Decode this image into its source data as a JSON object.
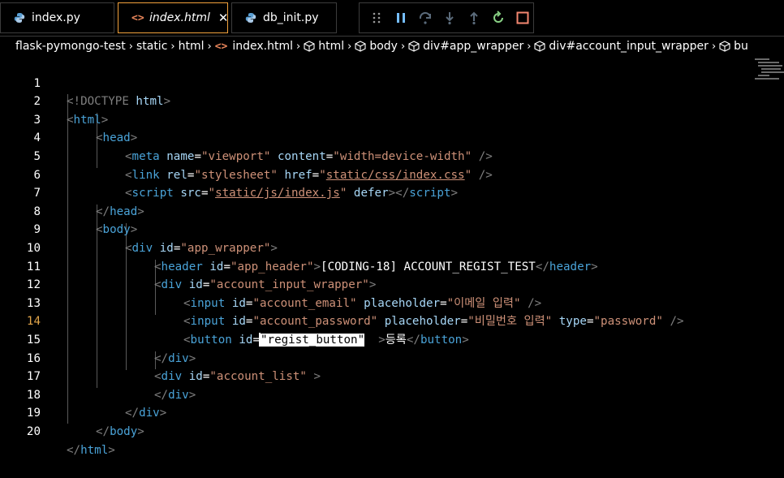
{
  "tabs": [
    {
      "label": "index.py",
      "icon": "python-icon",
      "active": false
    },
    {
      "label": "index.html",
      "icon": "html-icon",
      "active": true,
      "close": "✕"
    },
    {
      "label": "db_init.py",
      "icon": "python-icon",
      "active": false
    }
  ],
  "html_glyph": "<>",
  "debug_toolbar": [
    "drag-handle-icon",
    "pause-icon",
    "step-over-icon",
    "step-into-icon",
    "step-out-icon",
    "restart-icon",
    "stop-icon"
  ],
  "breadcrumb": {
    "segments": [
      "flask-pymongo-test",
      "static",
      "html",
      "index.html",
      "html",
      "body",
      "div#app_wrapper",
      "div#account_input_wrapper",
      "bu"
    ]
  },
  "editor": {
    "current_line": 14,
    "lines": [
      {
        "n": "1"
      },
      {
        "n": "2"
      },
      {
        "n": "3"
      },
      {
        "n": "4"
      },
      {
        "n": "5"
      },
      {
        "n": "6"
      },
      {
        "n": "7"
      },
      {
        "n": "8"
      },
      {
        "n": "9"
      },
      {
        "n": "10"
      },
      {
        "n": "11"
      },
      {
        "n": "12"
      },
      {
        "n": "13"
      },
      {
        "n": "14"
      },
      {
        "n": "15"
      },
      {
        "n": "16"
      },
      {
        "n": "17"
      },
      {
        "n": "18"
      },
      {
        "n": "19"
      },
      {
        "n": "20"
      }
    ],
    "code": {
      "doctype": "<!DOCTYPE",
      "html_kw": "html",
      "gt": ">",
      "lt": "<",
      "lt_slash": "</",
      "html": "html",
      "head": "head",
      "body": "body",
      "meta": "meta",
      "link": "link",
      "script": "script",
      "div": "div",
      "header": "header",
      "input": "input",
      "button": "button",
      "a_name": "name",
      "a_content": "content",
      "a_rel": "rel",
      "a_href": "href",
      "a_src": "src",
      "a_defer": "defer",
      "a_id": "id",
      "a_placeholder": "placeholder",
      "a_type": "type",
      "eq": "=",
      "v_viewport": "\"viewport\"",
      "v_width": "\"width=device-width\"",
      "v_stylesheet": "\"stylesheet\"",
      "q": "\"",
      "v_css": "static/css/index.css",
      "v_js": "static/js/index.js",
      "v_app_wrapper": "\"app_wrapper\"",
      "v_app_header": "\"app_header\"",
      "header_text": "[CODING-18] ACCOUNT_REGIST_TEST",
      "v_account_input_wrapper": "\"account_input_wrapper\"",
      "v_account_email": "\"account_email\"",
      "v_email_ph": "\"이메일 입력\"",
      "v_account_password": "\"account_password\"",
      "v_pw_ph": "\"비밀번호 입력\"",
      "v_password": "\"password\"",
      "v_regist_button": "\"regist_button\"",
      "button_text": "등록",
      "v_account_list": "\"account_list\"",
      "self_close": "/>",
      "space": " "
    }
  },
  "colors": {
    "tag": "#4aa3d8",
    "attr": "#a7d7f7",
    "string": "#ce9178",
    "text": "#ffffff",
    "active_tab_border": "#f2a23c",
    "current_line_number": "#e2a54a"
  }
}
